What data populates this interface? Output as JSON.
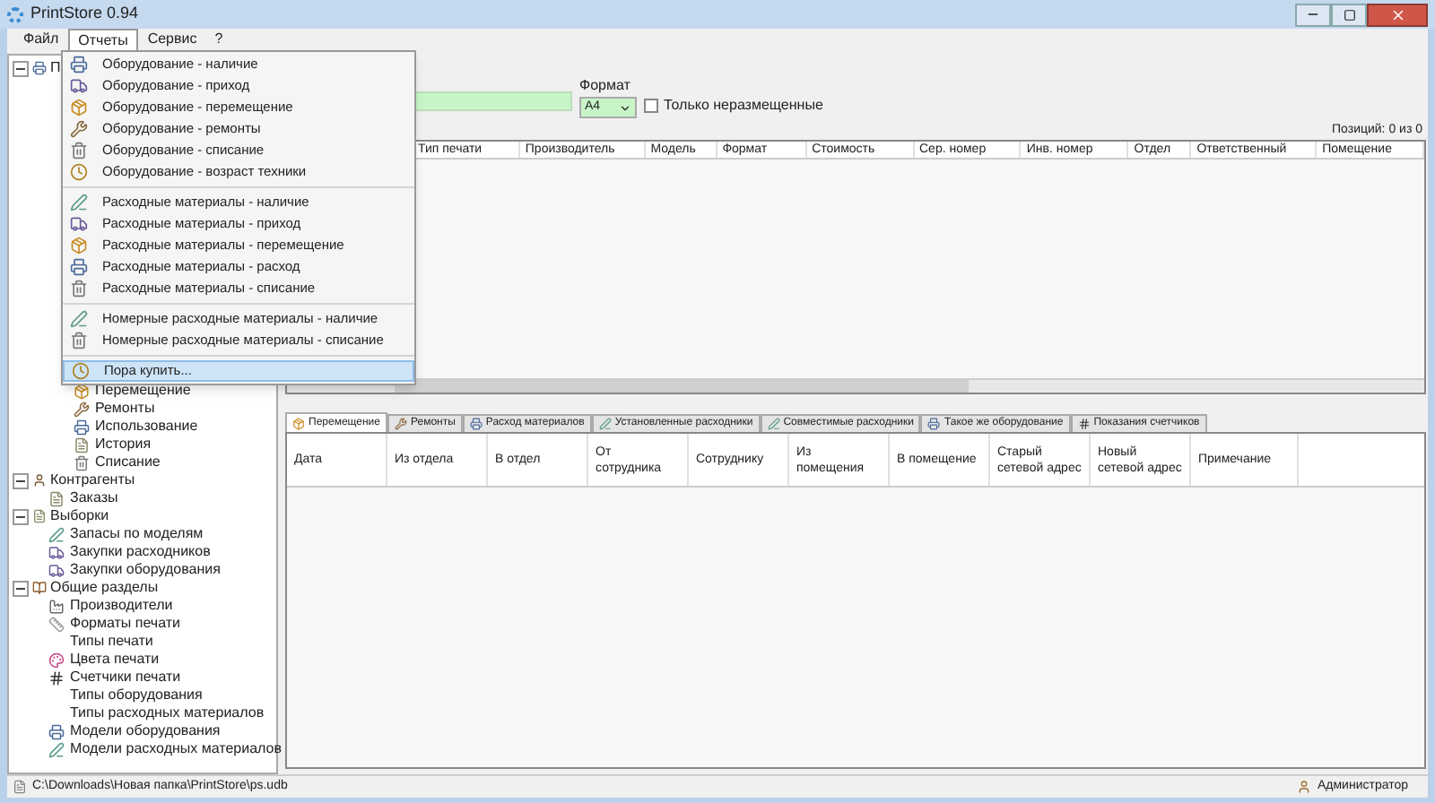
{
  "window": {
    "title": "PrintStore 0.94"
  },
  "menubar": [
    {
      "label": "Файл",
      "selected": false
    },
    {
      "label": "Отчеты",
      "selected": true
    },
    {
      "label": "Сервис",
      "selected": false
    },
    {
      "label": "?",
      "selected": false
    }
  ],
  "menu": {
    "groups": [
      [
        {
          "label": "Оборудование - наличие",
          "kind": "printer",
          "selected": false
        },
        {
          "label": "Оборудование - приход",
          "kind": "truck",
          "selected": false
        },
        {
          "label": "Оборудование - перемещение",
          "kind": "box",
          "selected": false
        },
        {
          "label": "Оборудование - ремонты",
          "kind": "wrench",
          "selected": false
        },
        {
          "label": "Оборудование - списание",
          "kind": "trash",
          "selected": false
        },
        {
          "label": "Оборудование - возраст техники",
          "kind": "clock",
          "selected": false
        }
      ],
      [
        {
          "label": "Расходные материалы - наличие",
          "kind": "pen",
          "selected": false
        },
        {
          "label": "Расходные материалы - приход",
          "kind": "truck",
          "selected": false
        },
        {
          "label": "Расходные материалы - перемещение",
          "kind": "box",
          "selected": false
        },
        {
          "label": "Расходные материалы - расход",
          "kind": "printer",
          "selected": false
        },
        {
          "label": "Расходные материалы - списание",
          "kind": "trash",
          "selected": false
        }
      ],
      [
        {
          "label": "Номерные расходные материалы - наличие",
          "kind": "pen",
          "selected": false
        },
        {
          "label": "Номерные расходные материалы - списание",
          "kind": "trash",
          "selected": false
        }
      ],
      [
        {
          "label": "Пора купить...",
          "kind": "clock",
          "selected": true
        }
      ]
    ]
  },
  "filter": {
    "format_label": "Формат",
    "format_value": "A4",
    "only_unplaced": {
      "label": "Только неразмещенные",
      "checked": false
    },
    "positions": "Позиций: 0 из 0"
  },
  "upper_table": {
    "columns": [
      "Тип печати",
      "Производитель",
      "Модель",
      "Формат",
      "Стоимость",
      "Сер. номер",
      "Инв. номер",
      "Отдел",
      "Ответственный",
      "Помещение"
    ]
  },
  "tree": [
    {
      "label": "П",
      "kind": "printer",
      "expanded": true,
      "children": [
        {
          "label": "Перемещение",
          "kind": "box"
        },
        {
          "label": "Ремонты",
          "kind": "wrench"
        },
        {
          "label": "Использование",
          "kind": "printer"
        },
        {
          "label": "История",
          "kind": "file"
        },
        {
          "label": "Списание",
          "kind": "trash"
        }
      ]
    },
    {
      "label": "Контрагенты",
      "kind": "user",
      "expanded": true,
      "children": [
        {
          "label": "Заказы",
          "kind": "file"
        }
      ]
    },
    {
      "label": "Выборки",
      "kind": "file",
      "expanded": true,
      "children": [
        {
          "label": "Запасы по моделям",
          "kind": "pen"
        },
        {
          "label": "Закупки расходников",
          "kind": "truck"
        },
        {
          "label": "Закупки оборудования",
          "kind": "truck"
        }
      ]
    },
    {
      "label": "Общие разделы",
      "kind": "book",
      "expanded": true,
      "children": [
        {
          "label": "Производители",
          "kind": "factory"
        },
        {
          "label": "Форматы печати",
          "kind": "ruler"
        },
        {
          "label": "Типы печати",
          "kind": "plain"
        },
        {
          "label": "Цвета печати",
          "kind": "palette"
        },
        {
          "label": "Счетчики печати",
          "kind": "counter"
        },
        {
          "label": "Типы оборудования",
          "kind": "plain"
        },
        {
          "label": "Типы расходных материалов",
          "kind": "plain"
        },
        {
          "label": "Модели оборудования",
          "kind": "printer"
        },
        {
          "label": "Модели расходных материалов",
          "kind": "pen"
        }
      ]
    }
  ],
  "tabs": [
    {
      "label": "Перемещение",
      "kind": "box",
      "selected": true
    },
    {
      "label": "Ремонты",
      "kind": "wrench",
      "selected": false
    },
    {
      "label": "Расход материалов",
      "kind": "printer",
      "selected": false
    },
    {
      "label": "Установленные расходники",
      "kind": "pen",
      "selected": false
    },
    {
      "label": "Совместимые расходники",
      "kind": "pen",
      "selected": false
    },
    {
      "label": "Такое же оборудование",
      "kind": "printer",
      "selected": false
    },
    {
      "label": "Показания счетчиков",
      "kind": "counter",
      "selected": false
    }
  ],
  "lower_table": {
    "columns": [
      "Дата",
      "Из отдела",
      "В отдел",
      "От сотрудника",
      "Сотруднику",
      "Из помещения",
      "В помещение",
      "Старый сетевой адрес",
      "Новый сетевой адрес",
      "Примечание"
    ]
  },
  "status_bar": {
    "path": "C:\\Downloads\\Новая папка\\PrintStore\\ps.udb",
    "user": "Администратор"
  }
}
